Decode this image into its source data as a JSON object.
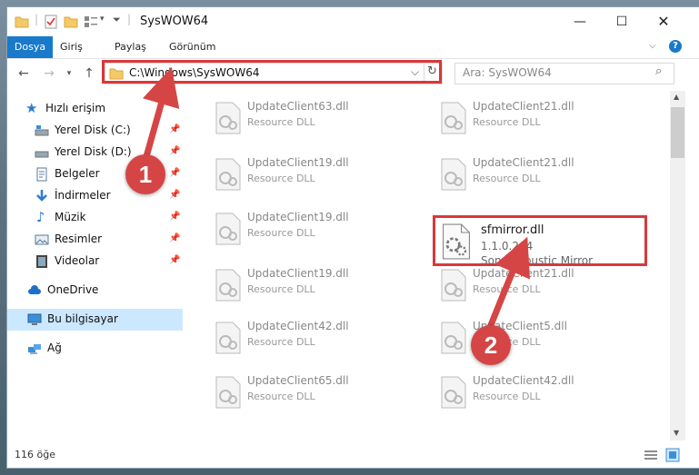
{
  "window": {
    "title": "SysWOW64"
  },
  "ribbon": {
    "tabs": [
      {
        "label": "Dosya",
        "active": true
      },
      {
        "label": "Giriş"
      },
      {
        "label": "Paylaş"
      },
      {
        "label": "Görünüm"
      }
    ]
  },
  "address": {
    "path": "C:\\Windows\\SysWOW64",
    "search_placeholder": "Ara: SysWOW64"
  },
  "sidebar": {
    "quick_access": "Hızlı erişim",
    "items": [
      {
        "label": "Yerel Disk (C:)",
        "icon": "drive-icon"
      },
      {
        "label": "Yerel Disk (D:)",
        "icon": "drive-icon"
      },
      {
        "label": "Belgeler",
        "icon": "documents-icon"
      },
      {
        "label": "İndirmeler",
        "icon": "download-icon"
      },
      {
        "label": "Müzik",
        "icon": "music-icon"
      },
      {
        "label": "Resimler",
        "icon": "pictures-icon"
      },
      {
        "label": "Videolar",
        "icon": "videos-icon"
      }
    ],
    "onedrive": "OneDrive",
    "this_pc": "Bu bilgisayar",
    "network": "Ağ"
  },
  "files": {
    "left_column": [
      {
        "name": "UpdateClient63.dll",
        "type": "Resource DLL"
      },
      {
        "name": "UpdateClient19.dll",
        "type": "Resource DLL"
      },
      {
        "name": "UpdateClient19.dll",
        "type": "Resource DLL"
      },
      {
        "name": "UpdateClient19.dll",
        "type": "Resource DLL"
      },
      {
        "name": "UpdateClient42.dll",
        "type": "Resource DLL"
      },
      {
        "name": "UpdateClient65.dll",
        "type": "Resource DLL"
      }
    ],
    "right_column": [
      {
        "name": "UpdateClient21.dll",
        "type": "Resource DLL"
      },
      {
        "name": "UpdateClient21.dll",
        "type": "Resource DLL"
      },
      {
        "name": "UpdateClient21.dll",
        "type": "Resource DLL"
      },
      {
        "name": "UpdateClient5.dll",
        "type": "Resource DLL"
      },
      {
        "name": "UpdateClient42.dll",
        "type": "Resource DLL"
      }
    ],
    "featured": {
      "name": "sfmirror.dll",
      "version": "1.1.0.244",
      "description": "Sony Acoustic Mirror"
    }
  },
  "status": {
    "count": "116 öğe"
  },
  "callouts": {
    "one": "1",
    "two": "2"
  },
  "colors": {
    "accent": "#1979ca",
    "callout": "#d64545",
    "selection": "#cce8ff"
  }
}
